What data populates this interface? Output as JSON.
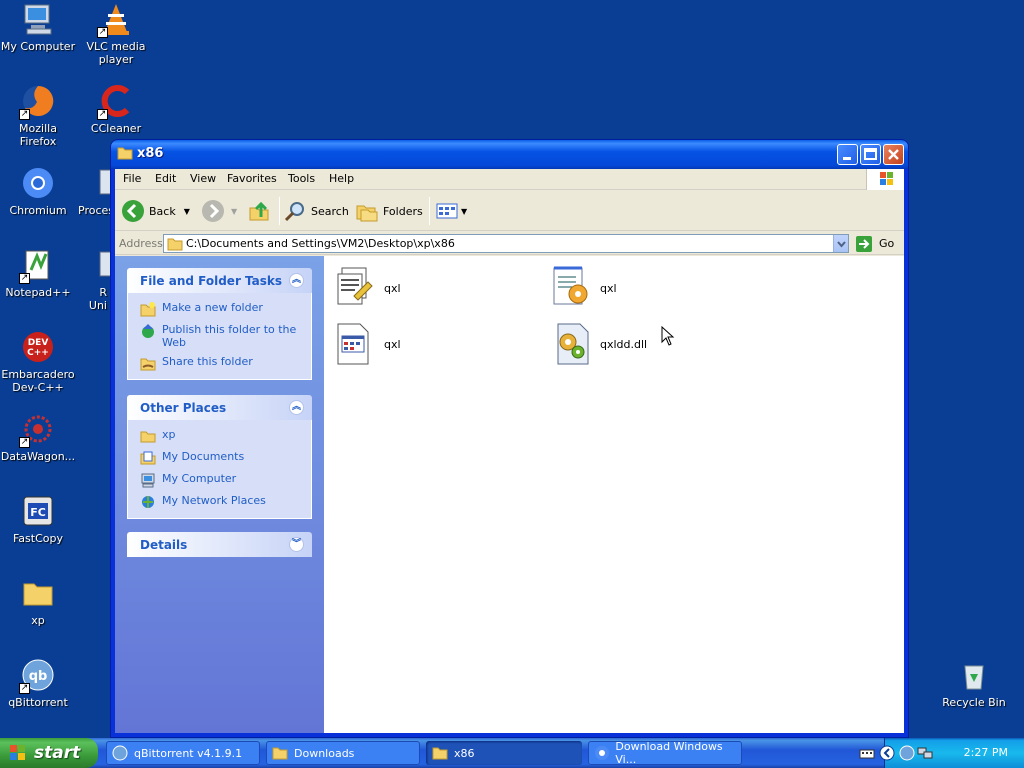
{
  "desktop": {
    "icons": [
      {
        "label": "My Computer",
        "icon": "my-computer-icon"
      },
      {
        "label": "VLC media player",
        "icon": "vlc-icon"
      },
      {
        "label": "Mozilla Firefox",
        "icon": "firefox-icon"
      },
      {
        "label": "CCleaner",
        "icon": "ccleaner-icon"
      },
      {
        "label": "Chromium",
        "icon": "chromium-icon"
      },
      {
        "label": "Proces",
        "icon": "process-explorer-icon"
      },
      {
        "label": "Notepad++",
        "icon": "notepadpp-icon"
      },
      {
        "label": "R Uni",
        "icon": "revo-uninstaller-icon"
      },
      {
        "label": "Embarcadero Dev-C++",
        "icon": "devcpp-icon"
      },
      {
        "label": "DataWagon...",
        "icon": "datawagon-icon"
      },
      {
        "label": "FastCopy",
        "icon": "fastcopy-icon"
      },
      {
        "label": "xp",
        "icon": "folder-icon"
      },
      {
        "label": "qBittorrent",
        "icon": "qbittorrent-icon"
      },
      {
        "label": "Recycle Bin",
        "icon": "recycle-bin-icon"
      }
    ]
  },
  "window": {
    "title": "x86",
    "menu": [
      "File",
      "Edit",
      "View",
      "Favorites",
      "Tools",
      "Help"
    ],
    "toolbar": {
      "back": "Back",
      "search": "Search",
      "folders": "Folders"
    },
    "address": {
      "label": "Address",
      "path": "C:\\Documents and Settings\\VM2\\Desktop\\xp\\x86",
      "go": "Go"
    },
    "taskpane": {
      "file_tasks": {
        "title": "File and Folder Tasks",
        "items": [
          "Make a new folder",
          "Publish this folder to the Web",
          "Share this folder"
        ]
      },
      "other_places": {
        "title": "Other Places",
        "items": [
          "xp",
          "My Documents",
          "My Computer",
          "My Network Places"
        ]
      },
      "details": {
        "title": "Details"
      }
    },
    "files": [
      {
        "name": "qxl",
        "icon": "security-catalog-icon"
      },
      {
        "name": "qxl",
        "icon": "setup-info-icon"
      },
      {
        "name": "qxl",
        "icon": "system-file-icon"
      },
      {
        "name": "qxldd.dll",
        "icon": "dll-icon"
      }
    ]
  },
  "taskbar": {
    "start": "start",
    "buttons": [
      "qBittorrent v4.1.9.1",
      "Downloads",
      "x86",
      "Download Windows Vi..."
    ],
    "active": "x86",
    "clock": "2:27 PM"
  },
  "colors": {
    "desktop": "#0a3e94",
    "taskpane_link": "#215dc6",
    "title_blue": "#0553e4"
  }
}
